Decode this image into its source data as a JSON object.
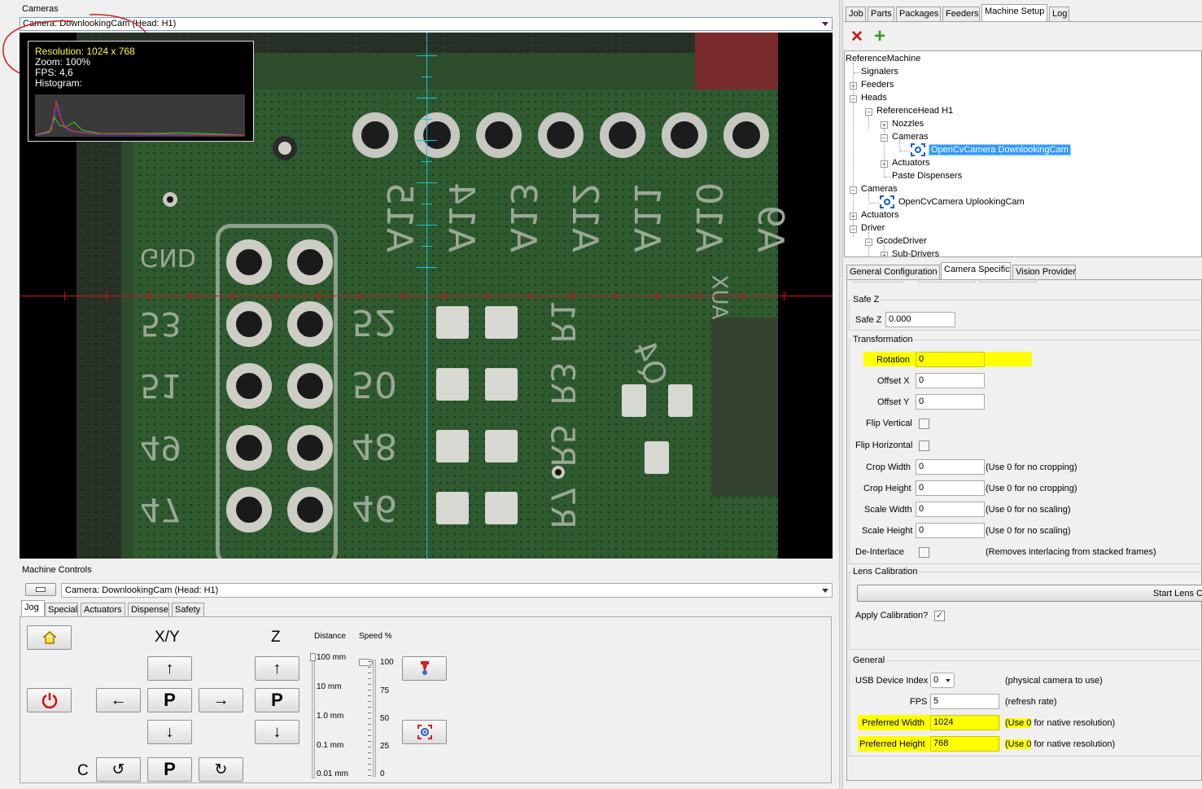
{
  "cameras_panel": {
    "title": "Cameras",
    "camera_select": "Camera: DownlookingCam (Head: H1)",
    "overlay": {
      "resolution": "Resolution: 1024 x 768",
      "zoom": "Zoom: 100%",
      "fps": "FPS: 4,6",
      "histogram": "Histogram:"
    },
    "pcb": {
      "labels_rot": [
        "A15",
        "A14",
        "A13",
        "A12",
        "A11",
        "A10",
        "A9"
      ],
      "left_labels": [
        "GND",
        "53",
        "51",
        "49",
        "47"
      ],
      "mid_labels": [
        "52",
        "50",
        "48",
        "46"
      ],
      "r_labels": [
        "R1",
        "R3",
        "R5",
        "R7"
      ],
      "q_label": "Q4",
      "aux_label": "AUX"
    }
  },
  "machine_controls": {
    "title": "Machine Controls",
    "camera_select": "Camera: DownlookingCam (Head: H1)",
    "tabs": [
      "Jog",
      "Special",
      "Actuators",
      "Dispense",
      "Safety"
    ],
    "xy_label": "X/Y",
    "z_label": "Z",
    "c_label": "C",
    "park_label": "P",
    "distance": {
      "label": "Distance",
      "steps": [
        "100 mm",
        "10 mm",
        "1.0 mm",
        "0.1 mm",
        "0.01 mm"
      ],
      "value": "100 mm"
    },
    "speed": {
      "label": "Speed %",
      "steps": [
        "100",
        "75",
        "50",
        "25",
        "0"
      ],
      "value": 100
    }
  },
  "right_panel": {
    "main_tabs": [
      "Job",
      "Parts",
      "Packages",
      "Feeders",
      "Machine Setup",
      "Log"
    ],
    "active_tab": "Machine Setup",
    "tree": [
      {
        "label": "ReferenceMachine",
        "level": 0
      },
      {
        "label": "Signalers",
        "level": 1
      },
      {
        "label": "Feeders",
        "level": 1
      },
      {
        "label": "Heads",
        "level": 1
      },
      {
        "label": "ReferenceHead H1",
        "level": 2
      },
      {
        "label": "Nozzles",
        "level": 3
      },
      {
        "label": "Cameras",
        "level": 3
      },
      {
        "label": "OpenCvCamera DownlookingCam",
        "level": 4,
        "selected": true
      },
      {
        "label": "Actuators",
        "level": 3
      },
      {
        "label": "Paste Dispensers",
        "level": 3
      },
      {
        "label": "Cameras",
        "level": 1
      },
      {
        "label": "OpenCvCamera UplookingCam",
        "level": 2
      },
      {
        "label": "Actuators",
        "level": 1
      },
      {
        "label": "Driver",
        "level": 1
      },
      {
        "label": "GcodeDriver",
        "level": 2
      },
      {
        "label": "Sub-Drivers",
        "level": 3
      }
    ],
    "sub_tabs": [
      "General Configuration",
      "Camera Specific",
      "Vision Provider"
    ],
    "safe_z": {
      "group": "Safe Z",
      "label": "Safe Z",
      "value": "0.000"
    },
    "transformation": {
      "group": "Transformation",
      "rotation_label": "Rotation",
      "rotation": "0",
      "offset_x_label": "Offset X",
      "offset_x": "0",
      "offset_y_label": "Offset Y",
      "offset_y": "0",
      "flip_vertical_label": "Flip Vertical",
      "flip_horizontal_label": "Flip Horizontal",
      "crop_width_label": "Crop Width",
      "crop_width": "0",
      "crop_width_hint": "(Use 0 for no cropping)",
      "crop_height_label": "Crop Height",
      "crop_height": "0",
      "crop_height_hint": "(Use 0 for no cropping)",
      "scale_width_label": "Scale Width",
      "scale_width": "0",
      "scale_width_hint": "(Use 0 for no scaling)",
      "scale_height_label": "Scale Height",
      "scale_height": "0",
      "scale_height_hint": "(Use 0 for no scaling)",
      "deinterlace_label": "De-Interlace",
      "deinterlace_hint": "(Removes interlacing from stacked frames)"
    },
    "lens_calibration": {
      "group": "Lens Calibration",
      "start_button": "Start Lens C",
      "apply_label": "Apply Calibration?",
      "apply_checked": true
    },
    "general": {
      "group": "General",
      "usb_label": "USB Device Index",
      "usb_value": "0",
      "usb_hint": "(physical camera to use)",
      "fps_label": "FPS",
      "fps_value": "5",
      "fps_hint": "(refresh rate)",
      "pref_width_label": "Preferred Width",
      "pref_width": "1024",
      "pref_height_label": "Preferred Height",
      "pref_height": "768",
      "native_hint_prefix": "(Use ",
      "native_hint_zero": "0",
      "native_hint_suffix": " for native resolution)"
    }
  }
}
